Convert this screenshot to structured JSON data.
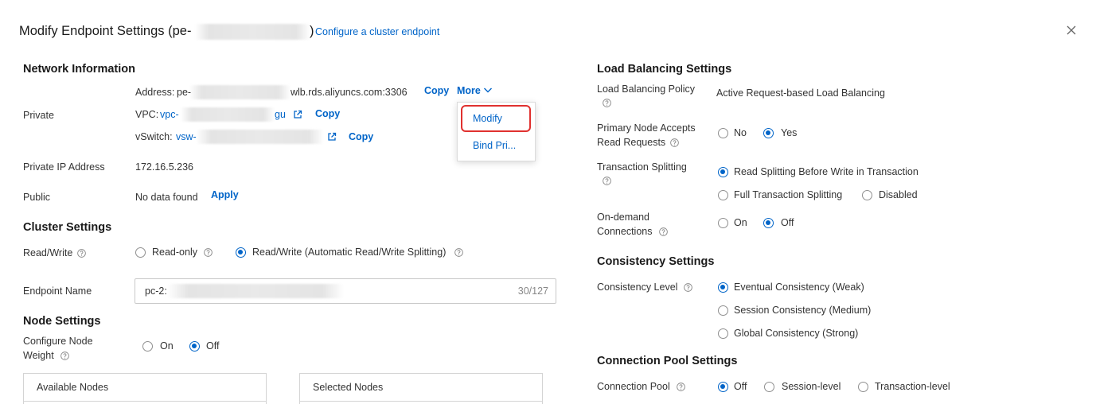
{
  "dialog": {
    "title_prefix": "Modify Endpoint Settings (pe-",
    "title_suffix": ")",
    "help_link": "Configure a cluster endpoint"
  },
  "network": {
    "heading": "Network Information",
    "private_label": "Private",
    "address": {
      "label": "Address:",
      "prefix": "pe-",
      "suffix": "wlb.rds.aliyuncs.com:3306",
      "copy": "Copy",
      "more": "More"
    },
    "vpc": {
      "label": "VPC:",
      "prefix": "vpc-",
      "suffix": "gu",
      "copy": "Copy"
    },
    "vswitch": {
      "label": "vSwitch:",
      "prefix": "vsw-",
      "copy": "Copy"
    },
    "private_ip": {
      "label": "Private IP Address",
      "value": "172.16.5.236"
    },
    "public": {
      "label": "Public",
      "value": "No data found",
      "apply": "Apply"
    }
  },
  "more_menu": {
    "items": [
      {
        "label": "Modify",
        "highlighted": true
      },
      {
        "label": "Bind Pri..."
      }
    ]
  },
  "cluster": {
    "heading": "Cluster Settings",
    "read_write": {
      "label": "Read/Write",
      "options": [
        {
          "label": "Read-only",
          "checked": false
        },
        {
          "label": "Read/Write (Automatic Read/Write Splitting)",
          "checked": true
        }
      ]
    },
    "endpoint_name": {
      "label": "Endpoint Name",
      "value": "pc-2:",
      "counter": "30/127"
    }
  },
  "node": {
    "heading": "Node Settings",
    "weight": {
      "label_line1": "Configure Node",
      "label_line2": "Weight",
      "options": [
        {
          "label": "On",
          "checked": false
        },
        {
          "label": "Off",
          "checked": true
        }
      ]
    },
    "available_header": "Available Nodes",
    "selected_header": "Selected Nodes"
  },
  "load_balancing": {
    "heading": "Load Balancing Settings",
    "policy": {
      "label": "Load Balancing Policy",
      "value": "Active Request-based Load Balancing"
    },
    "primary_read": {
      "label_line1": "Primary Node Accepts",
      "label_line2": "Read Requests",
      "options": [
        {
          "label": "No",
          "checked": false
        },
        {
          "label": "Yes",
          "checked": true
        }
      ]
    },
    "transaction_splitting": {
      "label": "Transaction Splitting",
      "options": [
        {
          "label": "Read Splitting Before Write in Transaction",
          "checked": true
        },
        {
          "label": "Full Transaction Splitting",
          "checked": false
        },
        {
          "label": "Disabled",
          "checked": false
        }
      ]
    },
    "on_demand": {
      "label_line1": "On-demand",
      "label_line2": "Connections",
      "options": [
        {
          "label": "On",
          "checked": false
        },
        {
          "label": "Off",
          "checked": true
        }
      ]
    }
  },
  "consistency": {
    "heading": "Consistency Settings",
    "level": {
      "label": "Consistency Level",
      "options": [
        {
          "label": "Eventual Consistency (Weak)",
          "checked": true
        },
        {
          "label": "Session Consistency (Medium)",
          "checked": false
        },
        {
          "label": "Global Consistency (Strong)",
          "checked": false
        }
      ]
    }
  },
  "connection_pool": {
    "heading": "Connection Pool Settings",
    "pool": {
      "label": "Connection Pool",
      "options": [
        {
          "label": "Off",
          "checked": true
        },
        {
          "label": "Session-level",
          "checked": false
        },
        {
          "label": "Transaction-level",
          "checked": false
        }
      ]
    }
  },
  "icons": {
    "close": "close-icon",
    "help": "help-icon",
    "external_link": "external-link-icon",
    "more_chevron": "chevron-down-icon"
  },
  "colors": {
    "link": "#0064c8",
    "text": "#333333",
    "highlight": "#e0312f"
  }
}
